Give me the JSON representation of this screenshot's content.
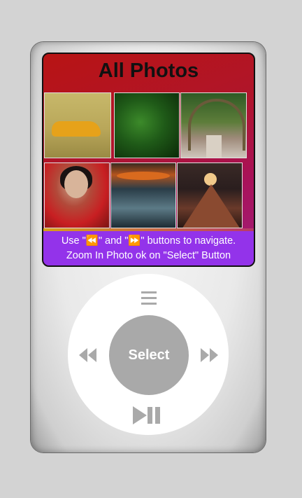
{
  "screen": {
    "title": "All Photos",
    "photos": [
      {
        "icon": "yellow-sports-car-photo"
      },
      {
        "icon": "green-fern-photo"
      },
      {
        "icon": "flower-archway-path-photo"
      },
      {
        "icon": "woman-red-dress-portrait-photo"
      },
      {
        "icon": "futuristic-corridor-photo"
      },
      {
        "icon": "moon-over-mountain-photo"
      }
    ],
    "help_line1": "Use \"⏪\" and \"⏩\" buttons to navigate.",
    "help_line2": "Zoom In Photo ok on \"Select\" Button"
  },
  "controls": {
    "select_label": "Select",
    "menu_icon": "menu-icon",
    "prev_icon": "rewind-icon",
    "next_icon": "fast-forward-icon",
    "play_pause_icon": "play-pause-icon"
  },
  "colors": {
    "background": "#d3d3d3",
    "screen_gradient_start": "#b81414",
    "screen_gradient_end": "#a01e7a",
    "footer": "#9333ea",
    "wheel": "#ffffff",
    "select_button": "#a9a9a9"
  }
}
